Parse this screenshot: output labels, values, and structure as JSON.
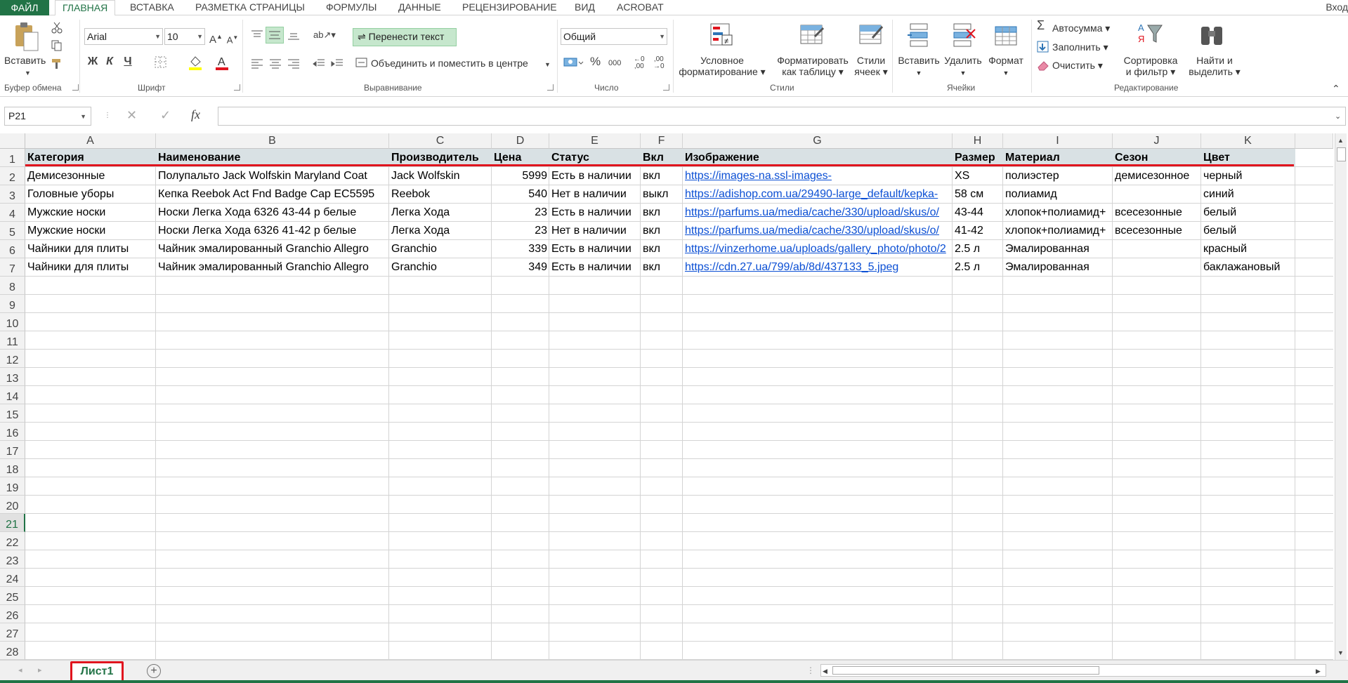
{
  "tabs": {
    "file": "ФАЙЛ",
    "items": [
      "ГЛАВНАЯ",
      "ВСТАВКА",
      "РАЗМЕТКА СТРАНИЦЫ",
      "ФОРМУЛЫ",
      "ДАННЫЕ",
      "РЕЦЕНЗИРОВАНИЕ",
      "ВИД",
      "ACROBAT"
    ],
    "active_index": 0,
    "signin": "Вход"
  },
  "ribbon": {
    "clipboard": {
      "paste": "Вставить",
      "label": "Буфер обмена"
    },
    "font": {
      "name": "Arial",
      "size": "10",
      "bold": "Ж",
      "italic": "К",
      "underline": "Ч",
      "label": "Шрифт"
    },
    "alignment": {
      "wrap": "Перенести текст",
      "merge": "Объединить и поместить в центре",
      "label": "Выравнивание"
    },
    "number": {
      "format": "Общий",
      "percent": "%",
      "thousands": "000",
      "label": "Число"
    },
    "styles": {
      "cond1": "Условное",
      "cond2": "форматирование",
      "fmt1": "Форматировать",
      "fmt2": "как таблицу",
      "cell1": "Стили",
      "cell2": "ячеек",
      "label": "Стили"
    },
    "cells": {
      "insert": "Вставить",
      "delete": "Удалить",
      "format": "Формат",
      "label": "Ячейки"
    },
    "editing": {
      "autosum": "Автосумма",
      "fill": "Заполнить",
      "clear": "Очистить",
      "sort1": "Сортировка",
      "sort2": "и фильтр",
      "find1": "Найти и",
      "find2": "выделить",
      "label": "Редактирование"
    }
  },
  "formula_bar": {
    "name_box": "P21",
    "fx": "fx",
    "value": ""
  },
  "columns": [
    "A",
    "B",
    "C",
    "D",
    "E",
    "F",
    "G",
    "H",
    "I",
    "J",
    "K"
  ],
  "rows": [
    [
      "Категория",
      "Наименование",
      "Производитель",
      "Цена",
      "Статус",
      "Вкл",
      "Изображение",
      "Размер",
      "Материал",
      "Сезон",
      "Цвет"
    ],
    [
      "Демисезонные",
      "Полупальто Jack Wolfskin Maryland Coat",
      "Jack Wolfskin",
      "5999",
      "Есть в наличии",
      "вкл",
      "https://images-na.ssl-images-",
      "XS",
      "полиэстер",
      "демисезонное",
      "черный"
    ],
    [
      "Головные уборы",
      "Кепка Reebok Act Fnd Badge Cap EC5595",
      "Reebok",
      "540",
      "Нет в наличии",
      "выкл",
      "https://adishop.com.ua/29490-large_default/kepka-",
      "58 см",
      "полиамид",
      "",
      "синий"
    ],
    [
      "Мужские носки",
      "Носки Легка Хода 6326 43-44 р белые",
      "Легка Хода",
      "23",
      "Есть в наличии",
      "вкл",
      "https://parfums.ua/media/cache/330/upload/skus/o/",
      "43-44",
      "хлопок+полиамид+",
      "всесезонные",
      "белый"
    ],
    [
      "Мужские носки",
      "Носки Легка Хода 6326 41-42 р белые",
      "Легка Хода",
      "23",
      "Нет в наличии",
      "вкл",
      "https://parfums.ua/media/cache/330/upload/skus/o/",
      "41-42",
      "хлопок+полиамид+",
      "всесезонные",
      "белый"
    ],
    [
      "Чайники для плиты",
      "Чайник эмалированный Granchio Allegro",
      "Granchio",
      "339",
      "Есть в наличии",
      "вкл",
      "https://vinzerhome.ua/uploads/gallery_photo/photo/2",
      "2.5 л",
      "Эмалированная",
      "",
      "красный"
    ],
    [
      "Чайники для плиты",
      "Чайник эмалированный Granchio Allegro",
      "Granchio",
      "349",
      "Есть в наличии",
      "вкл",
      "https://cdn.27.ua/799/ab/8d/437133_5.jpeg",
      "2.5 л",
      "Эмалированная",
      "",
      "баклажановый"
    ]
  ],
  "row_numbers": [
    "1",
    "2",
    "3",
    "4",
    "5",
    "6",
    "7",
    "8",
    "9",
    "10",
    "11",
    "12",
    "13",
    "14",
    "15",
    "16",
    "17",
    "18",
    "19",
    "20",
    "21",
    "22",
    "23",
    "24",
    "25",
    "26",
    "27",
    "28"
  ],
  "selected_row": "21",
  "sheet": {
    "tab": "Лист1",
    "add": "+"
  },
  "colors": {
    "accent": "#217346",
    "highlight": "#e0141e",
    "link": "#0b4fd4",
    "header_fill": "#d9e1e4"
  }
}
